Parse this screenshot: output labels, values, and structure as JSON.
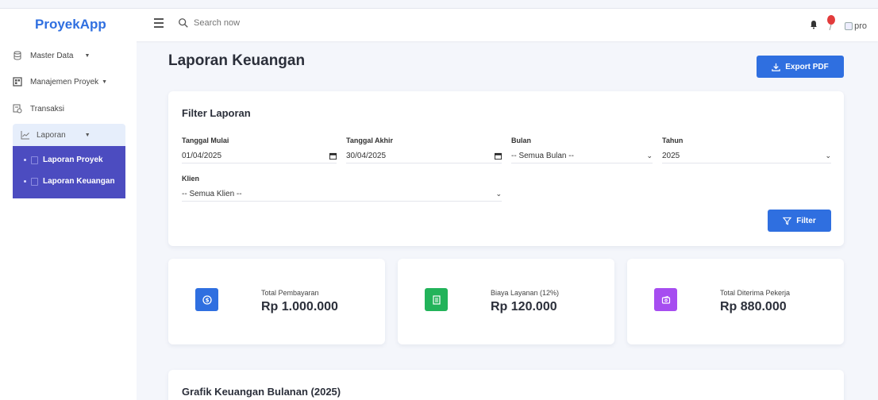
{
  "app": {
    "brand": "ProyekApp"
  },
  "search": {
    "placeholder": "Search now"
  },
  "header": {
    "avatar_alt": "pro"
  },
  "sidebar": {
    "items": [
      {
        "label": "Master Data"
      },
      {
        "label": "Manajemen Proyek"
      },
      {
        "label": "Transaksi"
      },
      {
        "label": "Laporan"
      }
    ],
    "submenu": [
      {
        "label": "Laporan Proyek"
      },
      {
        "label": "Laporan Keuangan"
      }
    ]
  },
  "page": {
    "title": "Laporan Keuangan",
    "export_label": "Export PDF"
  },
  "filter": {
    "title": "Filter Laporan",
    "tanggal_mulai": {
      "label": "Tanggal Mulai",
      "value": "01/04/2025"
    },
    "tanggal_akhir": {
      "label": "Tanggal Akhir",
      "value": "30/04/2025"
    },
    "bulan": {
      "label": "Bulan",
      "value": "-- Semua Bulan --"
    },
    "tahun": {
      "label": "Tahun",
      "value": "2025"
    },
    "klien": {
      "label": "Klien",
      "value": "-- Semua Klien --"
    },
    "button_label": "Filter"
  },
  "stats": [
    {
      "label": "Total Pembayaran",
      "value": "Rp 1.000.000",
      "icon": "dollar-icon",
      "color": "#2f6fe0"
    },
    {
      "label": "Biaya Layanan (12%)",
      "value": "Rp 120.000",
      "icon": "receipt-icon",
      "color": "#22b35a"
    },
    {
      "label": "Total Diterima Pekerja",
      "value": "Rp 880.000",
      "icon": "wallet-icon",
      "color": "#a64df0"
    }
  ],
  "chart": {
    "title": "Grafik Keuangan Bulanan (2025)"
  }
}
